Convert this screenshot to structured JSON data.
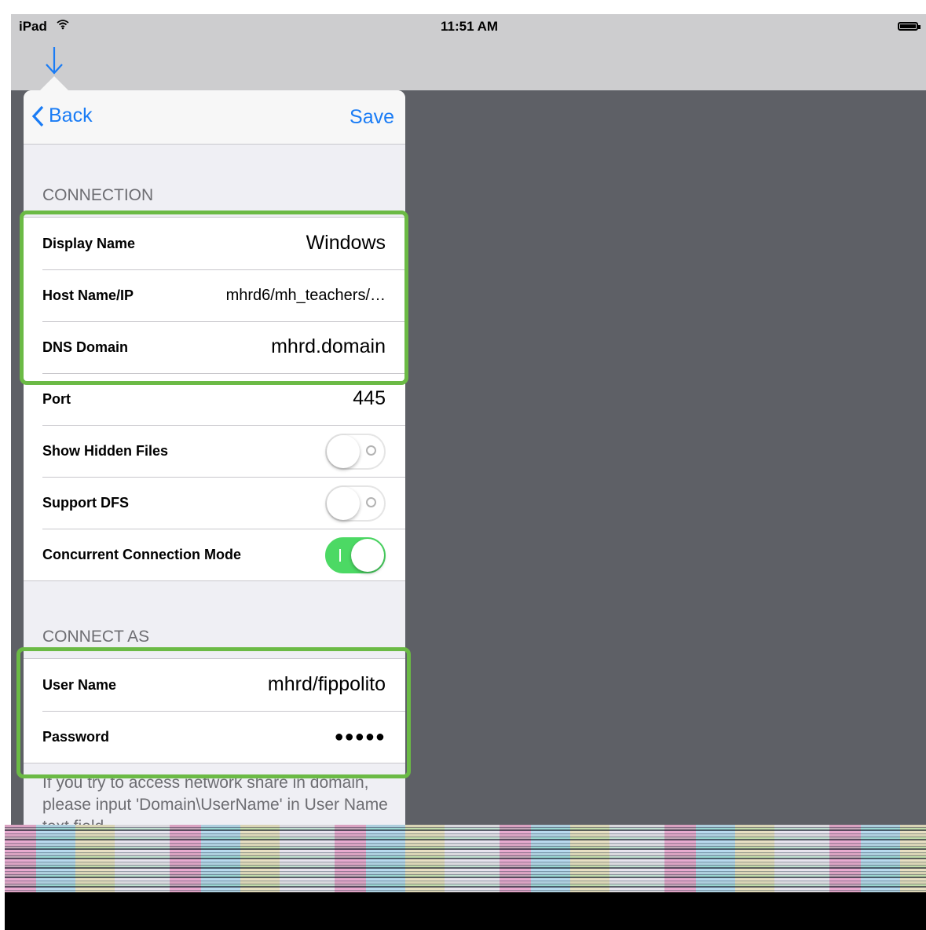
{
  "status_bar": {
    "carrier": "iPad",
    "wifi_icon": "wifi-icon",
    "time": "11:51 AM",
    "battery_icon": "battery-icon"
  },
  "toolbar": {
    "download_icon": "download-arrow-icon"
  },
  "navbar": {
    "back_label": "Back",
    "save_label": "Save"
  },
  "connection": {
    "header": "CONNECTION",
    "display_name_label": "Display Name",
    "display_name_value": "Windows",
    "host_label": "Host Name/IP",
    "host_value": "mhrd6/mh_teachers/…",
    "dns_label": "DNS Domain",
    "dns_value": "mhrd.domain",
    "port_label": "Port",
    "port_value": "445",
    "hidden_files_label": "Show Hidden Files",
    "hidden_files_on": false,
    "dfs_label": "Support DFS",
    "dfs_on": false,
    "concurrent_label": "Concurrent Connection Mode",
    "concurrent_on": true
  },
  "connect_as": {
    "header": "CONNECT AS",
    "user_label": "User Name",
    "user_value": "mhrd/fippolito",
    "password_label": "Password",
    "password_value": "●●●●●"
  },
  "footer_note": "If you try to access network share in domain, please input 'Domain\\UserName' in User Name text field.",
  "colors": {
    "accent": "#1a7cf5",
    "toggle_on": "#4cd964",
    "highlight": "#6bba45",
    "backdrop": "#5e6066"
  }
}
